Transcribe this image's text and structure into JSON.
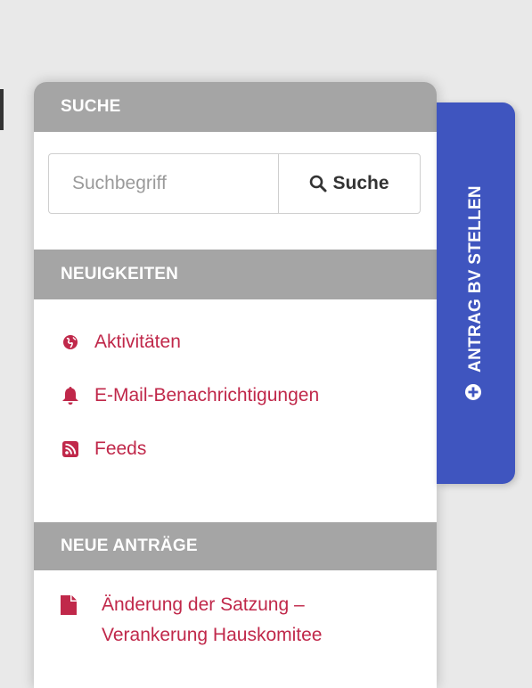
{
  "sidebar": {
    "search": {
      "title": "SUCHE",
      "placeholder": "Suchbegriff",
      "button_label": "Suche"
    },
    "news": {
      "title": "NEUIGKEITEN",
      "items": [
        {
          "label": "Aktivitäten",
          "icon": "globe-icon"
        },
        {
          "label": "E-Mail-Benachrichtigungen",
          "icon": "bell-icon"
        },
        {
          "label": "Feeds",
          "icon": "rss-feed-icon"
        }
      ]
    },
    "motions": {
      "title": "NEUE ANTRÄGE",
      "items": [
        {
          "label": "Änderung der Satzung – Verankerung Hauskomitee",
          "icon": "document-icon"
        }
      ]
    }
  },
  "side_tab": {
    "label": "ANTRAG BV STELLEN",
    "icon": "plus-circle-icon"
  },
  "colors": {
    "link": "#c0284a",
    "header_bg": "#a5a5a5",
    "tab_bg": "#3f55bf"
  }
}
